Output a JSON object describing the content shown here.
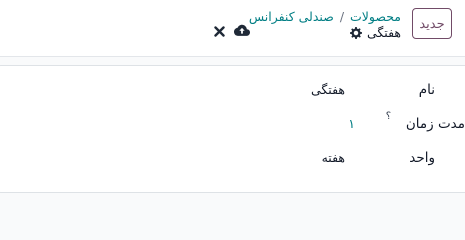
{
  "header": {
    "new_button_label": "جدید",
    "breadcrumb": [
      {
        "label": "محصولات"
      },
      {
        "label": "صندلی کنفرانس"
      }
    ],
    "breadcrumb_separator": "/",
    "record_name": "هفتگی",
    "icons": {
      "settings": "gear-icon",
      "save": "cloud-upload-icon",
      "discard": "close-icon"
    }
  },
  "form": {
    "fields": [
      {
        "label": "نام",
        "value": "هفتگی"
      },
      {
        "label": "مدت زمان",
        "help": "؟",
        "value": "۱"
      },
      {
        "label": "واحد",
        "value": "هفته"
      }
    ]
  },
  "colors": {
    "accent": "#714b67",
    "link": "#017e84"
  }
}
